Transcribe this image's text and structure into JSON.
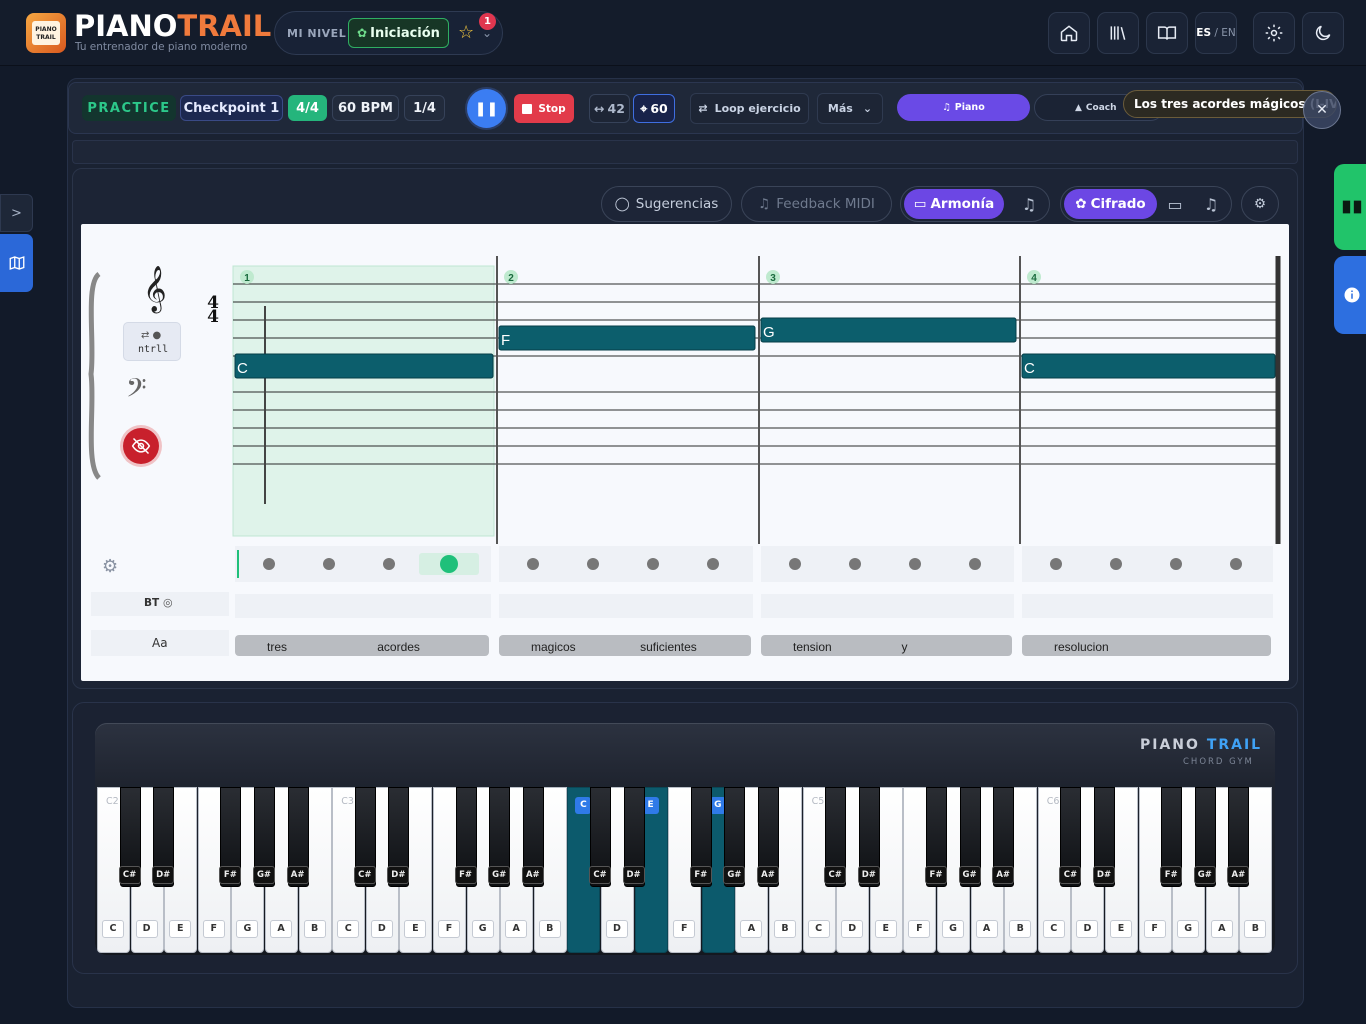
{
  "header": {
    "logo_text": "PIANO TRAIL",
    "brand_part1": "PIANO",
    "brand_part2": "TRAIL",
    "tagline": "Tu entrenador de piano moderno",
    "level_label": "MI NIVEL",
    "level_value": "Iniciación",
    "level_badge": "1",
    "lang_es": "ES",
    "lang_sep": " / ",
    "lang_en": "EN"
  },
  "toolbar": {
    "practice": "PRACTICE",
    "checkpoint": "Checkpoint 1",
    "beat": "4/4",
    "bpm": "60 BPM",
    "fraction": "1/4",
    "stop": "Stop",
    "range": "42",
    "target": "60",
    "loop": "Loop ejercicio",
    "more": "Más",
    "piano_tab": "Piano",
    "coach_tab": "Coach",
    "tooltip": "Los tres acordes mágicos (I-IV-V)"
  },
  "score_toolbar": {
    "suggestions": "Sugerencias",
    "midi_feedback": "Feedback MIDI",
    "harmony": "Armonía",
    "cipher": "Cifrado"
  },
  "score": {
    "time_sig_top": "4",
    "time_sig_bottom": "4",
    "controls_label": "ntrll",
    "bt_label": "BT",
    "lyrics_label": "Aa",
    "measures": [
      {
        "number": "1",
        "chord": "C",
        "beats": 4,
        "active_beat": 4
      },
      {
        "number": "2",
        "chord": "F",
        "beats": 4
      },
      {
        "number": "3",
        "chord": "G",
        "beats": 4
      },
      {
        "number": "4",
        "chord": "C",
        "beats": 4
      }
    ],
    "lyrics": [
      {
        "a": "tres",
        "b": "acordes"
      },
      {
        "a": "magicos",
        "b": "suficientes"
      },
      {
        "a": "tension",
        "b": "y"
      },
      {
        "a": "resolucion",
        "b": ""
      }
    ]
  },
  "piano": {
    "brand_a": "PIANO",
    "brand_b": "TRAIL",
    "sub": "CHORD GYM",
    "octave_labels": [
      "C2",
      "C3",
      "C4",
      "C5",
      "C6"
    ],
    "white_names": [
      "C",
      "D",
      "E",
      "F",
      "G",
      "A",
      "B"
    ],
    "black_names": [
      "C#",
      "D#",
      "F#",
      "G#",
      "A#"
    ],
    "highlighted": [
      "C",
      "E",
      "G"
    ],
    "accent": "#0c5a6c"
  }
}
